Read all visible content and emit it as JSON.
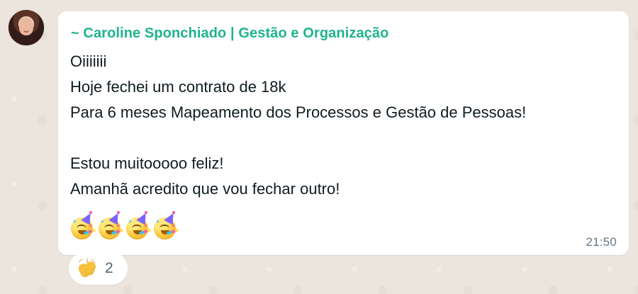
{
  "message": {
    "sender_name": "~ Caroline Sponchiado | Gestão e Organização",
    "lines": [
      "Oiiiiiii",
      "Hoje fechei um contrato de 18k",
      "Para 6 meses Mapeamento dos Processos e Gestão de Pessoas!",
      "",
      "Estou muitooooo feliz!",
      "Amanhã acredito que vou fechar outro!"
    ],
    "emoji_icons": [
      "party-face-icon",
      "party-face-icon",
      "party-face-icon",
      "party-face-icon"
    ],
    "time": "21:50"
  },
  "reaction": {
    "icon": "clapping-hands-icon",
    "count": "2"
  },
  "colors": {
    "background": "#ece5dd",
    "bubble": "#ffffff",
    "sender_name": "#1fb38c",
    "timestamp": "#667781"
  }
}
